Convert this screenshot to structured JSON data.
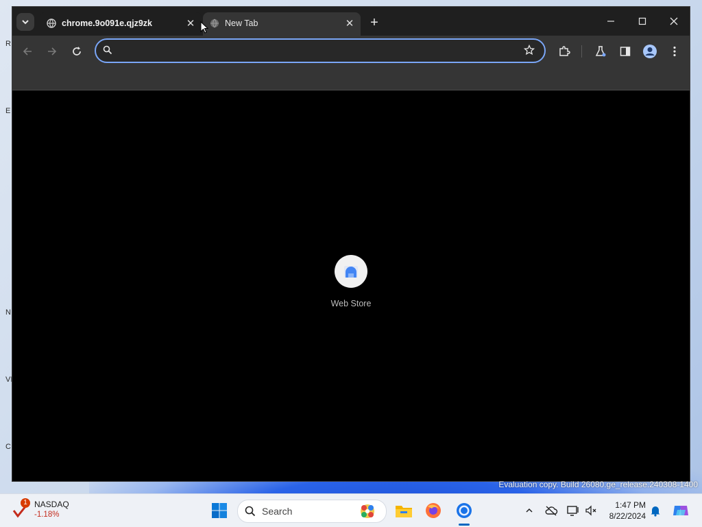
{
  "desktop": {
    "edge_letters": [
      "R",
      "E",
      "N",
      "VI",
      "C"
    ]
  },
  "browser": {
    "tab_search_icon": "chevron-down-icon",
    "tabs": [
      {
        "title": "chrome.9o091e.qjz9zk",
        "close": "✕",
        "active": false
      },
      {
        "title": "New Tab",
        "close": "✕",
        "active": true
      }
    ],
    "new_tab_symbol": "+",
    "window_controls": {
      "minimize": "—",
      "maximize": "☐",
      "close": "✕"
    },
    "omnibox": {
      "value": "",
      "placeholder": ""
    },
    "shortcuts": [
      {
        "label": "Web Store",
        "icon": "web-store-icon"
      }
    ],
    "colors": {
      "accent": "#7aa6f7",
      "toolbar": "#353535",
      "tabstrip": "#1f1f1f"
    }
  },
  "watermark": "Evaluation copy. Build 26080.ge_release.240308-1400",
  "taskbar": {
    "widget": {
      "badge": "1",
      "name": "NASDAQ",
      "change": "-1.18%"
    },
    "search_label": "Search",
    "time": "1:47 PM",
    "date": "8/22/2024",
    "apps": [
      "file-explorer-icon",
      "firefox-icon",
      "chrome-icon"
    ]
  }
}
